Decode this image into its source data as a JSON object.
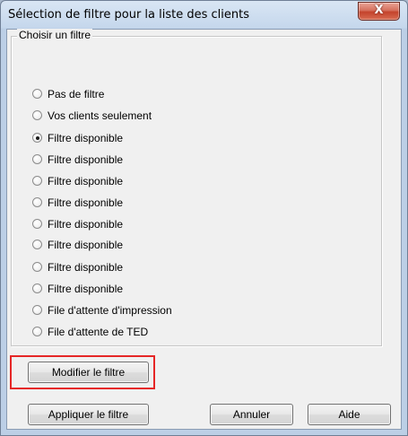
{
  "window": {
    "title": "Sélection de filtre pour la liste des clients",
    "close_label": "X"
  },
  "filter_group": {
    "title": "Choisir un filtre",
    "options": [
      {
        "label": "Pas de filtre",
        "checked": false
      },
      {
        "label": "Vos clients seulement",
        "checked": false
      },
      {
        "label": "Filtre disponible",
        "checked": true
      },
      {
        "label": "Filtre disponible",
        "checked": false
      },
      {
        "label": "Filtre disponible",
        "checked": false
      },
      {
        "label": "Filtre disponible",
        "checked": false
      },
      {
        "label": "Filtre disponible",
        "checked": false
      },
      {
        "label": "Filtre disponible",
        "checked": false
      },
      {
        "label": "Filtre disponible",
        "checked": false
      },
      {
        "label": "Filtre disponible",
        "checked": false
      },
      {
        "label": "File d'attente d'impression",
        "checked": false
      },
      {
        "label": "File d'attente de TED",
        "checked": false
      }
    ]
  },
  "buttons": {
    "modify": "Modifier le filtre",
    "apply": "Appliquer le filtre",
    "cancel": "Annuler",
    "help": "Aide"
  },
  "colors": {
    "highlight": "#e52626",
    "close_button": "#c4432c"
  }
}
